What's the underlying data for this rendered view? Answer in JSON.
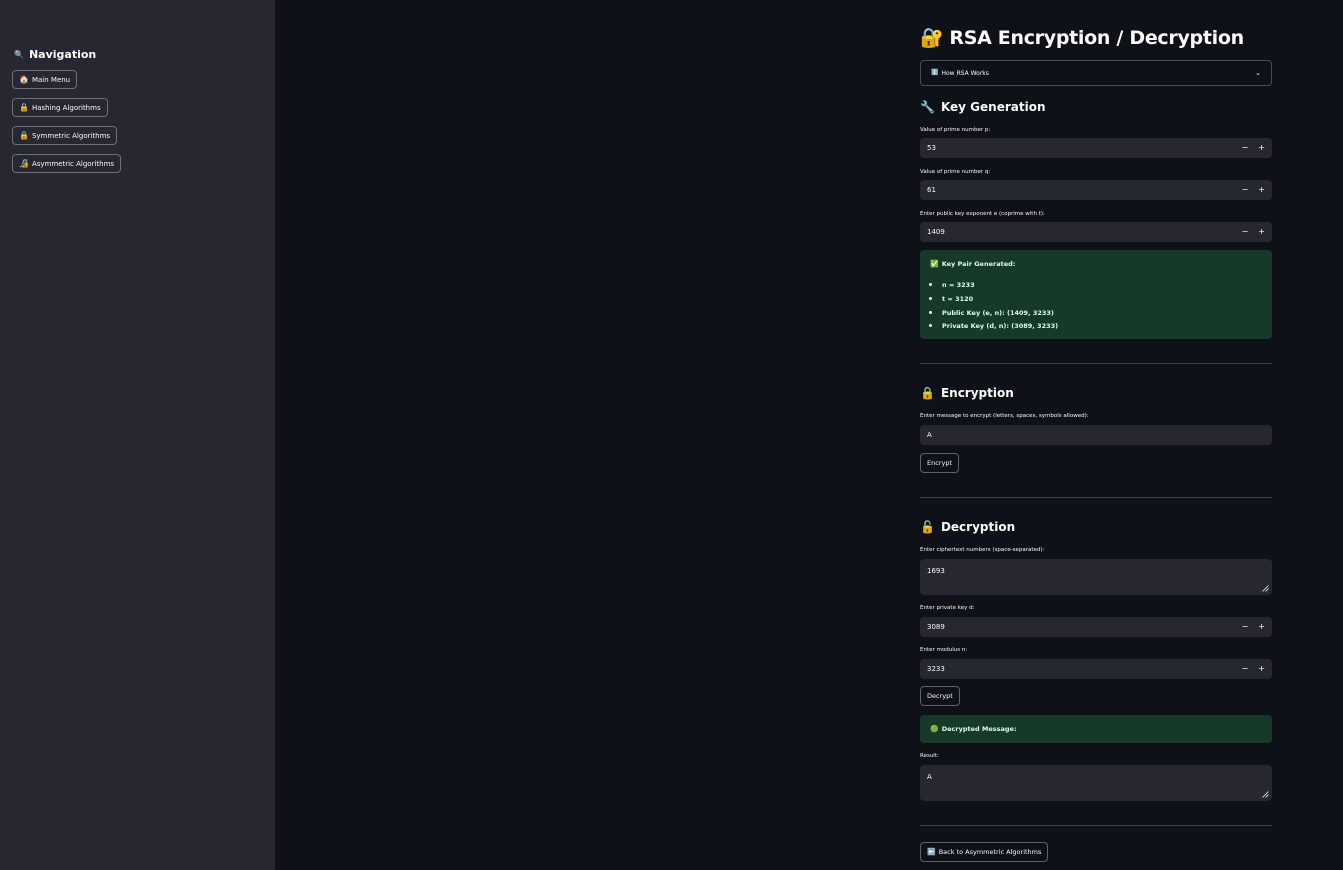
{
  "sidebar": {
    "title": "Navigation",
    "title_icon": "magnifier-icon",
    "items": [
      {
        "label": "Main Menu",
        "icon": "house-icon"
      },
      {
        "label": "Hashing Algorithms",
        "icon": "lock-icon"
      },
      {
        "label": "Symmetric Algorithms",
        "icon": "lock-icon"
      },
      {
        "label": "Asymmetric Algorithms",
        "icon": "lock-with-pen-icon"
      }
    ]
  },
  "page": {
    "title": "RSA Encryption / Decryption",
    "title_icon": "lock-with-key-icon",
    "expander_label": "How RSA Works"
  },
  "keygen": {
    "heading": "Key Generation",
    "p_label": "Value of prime number p:",
    "p_value": "53",
    "q_label": "Value of prime number q:",
    "q_value": "61",
    "e_label": "Enter public key exponent e (coprime with t):",
    "e_value": "1409",
    "result_title": "Key Pair Generated:",
    "results": [
      "n = 3233",
      "t = 3120",
      "Public Key (e, n): (1409, 3233)",
      "Private Key (d, n): (3089, 3233)"
    ]
  },
  "encryption": {
    "heading": "Encryption",
    "msg_label": "Enter message to encrypt (letters, spaces, symbols allowed):",
    "msg_value": "A",
    "button": "Encrypt"
  },
  "decryption": {
    "heading": "Decryption",
    "cipher_label": "Enter ciphertext numbers (space-separated):",
    "cipher_value": "1693",
    "d_label": "Enter private key d:",
    "d_value": "3089",
    "n_label": "Enter modulus n:",
    "n_value": "3233",
    "button": "Decrypt",
    "success_title": "Decrypted Message:",
    "result_label": "Result:",
    "result_value": "A"
  },
  "footer": {
    "back_button": "Back to Asymmetric Algorithms"
  },
  "colors": {
    "background": "#0e1117",
    "sidebar": "#262730",
    "input": "#262730",
    "success": "#173928"
  }
}
